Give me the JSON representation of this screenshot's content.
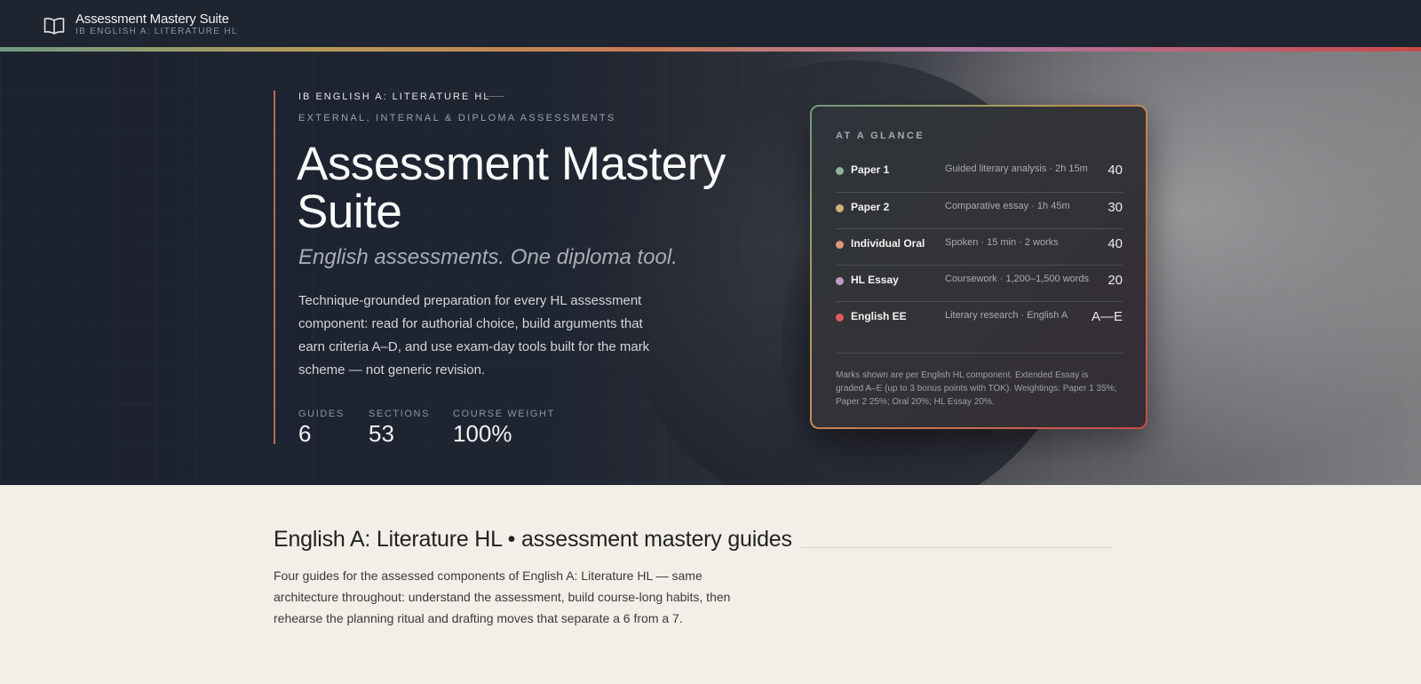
{
  "header": {
    "title": "Assessment Mastery Suite",
    "subtitle": "IB ENGLISH A: LITERATURE HL",
    "logo_icon": "open-book-icon"
  },
  "hero": {
    "eyebrow": "IB ENGLISH A: LITERATURE HL",
    "eyebrow_secondary": "EXTERNAL, INTERNAL & DIPLOMA ASSESSMENTS",
    "title": "Assessment Mastery Suite",
    "tagline": "English assessments. One diploma tool.",
    "description": "Technique-grounded preparation for every HL assessment component: read for authorial choice, build arguments that earn criteria A–D, and use exam-day tools built for the mark scheme — not generic revision.",
    "stats": [
      {
        "label": "GUIDES",
        "value": "6"
      },
      {
        "label": "SECTIONS",
        "value": "53"
      },
      {
        "label": "COURSE WEIGHT",
        "value": "100%"
      }
    ]
  },
  "glance": {
    "title": "AT A GLANCE",
    "rows": [
      {
        "name": "Paper 1",
        "desc": "Guided literary analysis · 2h 15m",
        "marks": "40",
        "color": "#8fb39e"
      },
      {
        "name": "Paper 2",
        "desc": "Comparative essay · 1h 45m",
        "marks": "30",
        "color": "#d1b27a"
      },
      {
        "name": "Individual Oral",
        "desc": "Spoken · 15 min · 2 works",
        "marks": "40",
        "color": "#e0977d"
      },
      {
        "name": "HL Essay",
        "desc": "Coursework · 1,200–1,500 words",
        "marks": "20",
        "color": "#c59ac0"
      },
      {
        "name": "English EE",
        "desc": "Literary research · English A",
        "marks": "A—E",
        "color": "#e05a5a"
      }
    ],
    "note": "Marks shown are per English HL component. Extended Essay is graded A–E (up to 3 bonus points with TOK). Weightings: Paper 1 35%; Paper 2 25%; Oral 20%; HL Essay 20%."
  },
  "section": {
    "title": "English A: Literature HL • assessment mastery guides",
    "description": "Four guides for the assessed components of English A: Literature HL — same architecture throughout: understand the assessment, build course-long habits, then rehearse the planning ritual and drafting moves that separate a 6 from a 7."
  }
}
